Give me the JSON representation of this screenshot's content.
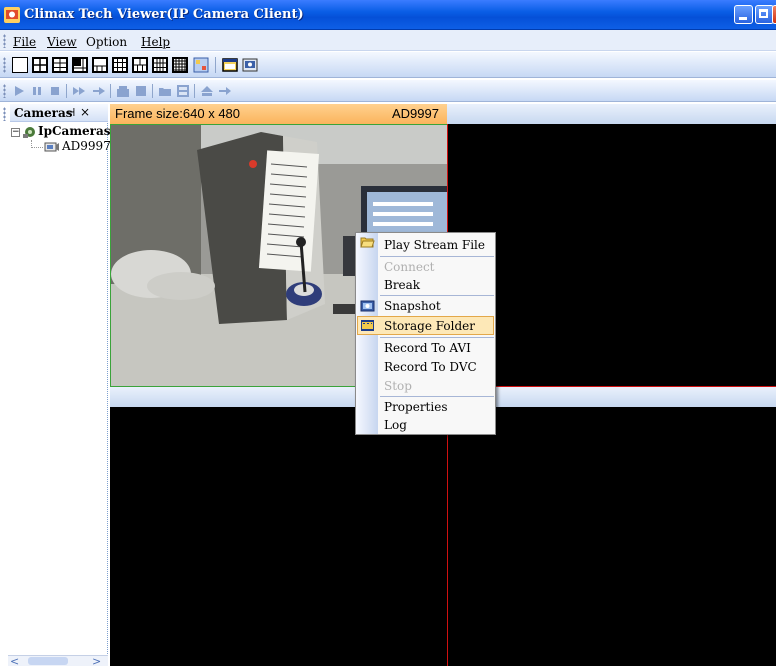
{
  "window": {
    "title": "Climax Tech Viewer(IP Camera Client)"
  },
  "menu": {
    "items": [
      "File",
      "View",
      "Option",
      "Help"
    ],
    "underline_letters": [
      "F",
      "V",
      "p",
      "H"
    ]
  },
  "toolbar1": {
    "icons": [
      "layout-1x1-icon",
      "layout-2x2-icon",
      "layout-3x3-icon",
      "layout-1plus5-icon",
      "layout-1plus7-icon",
      "layout-4x4-icon",
      "layout-2x3-icon",
      "layout-3x4-icon",
      "layout-5x5-icon",
      "settings-grid-icon",
      "fullscreen-icon",
      "snapshot-gallery-icon"
    ]
  },
  "toolbar2": {
    "icons": [
      "play-icon",
      "pause-icon",
      "stop-icon",
      "fast-forward-icon",
      "step-forward-icon",
      "record-icon",
      "stop-record-icon",
      "open-folder-icon",
      "storage-icon",
      "upload-icon",
      "arrow-right-icon"
    ]
  },
  "cameras_panel": {
    "title": "Cameras",
    "pin_glyph": "⊣",
    "close_glyph": "×",
    "tree": {
      "root_label": "IpCameras",
      "expand_glyph": "−",
      "children": [
        "AD9997"
      ]
    }
  },
  "video": {
    "frame_size_label": "Frame size:640 x 480",
    "camera_name": "AD9997"
  },
  "context_menu": {
    "items": [
      {
        "label": "Play Stream File",
        "enabled": true,
        "icon": "open-folder-icon"
      },
      {
        "label": "Connect",
        "enabled": false
      },
      {
        "label": "Break",
        "enabled": true
      },
      {
        "label": "Snapshot",
        "enabled": true,
        "icon": "camera-icon"
      },
      {
        "label": "Storage Folder",
        "enabled": true,
        "icon": "folder-film-icon",
        "highlighted": true
      },
      {
        "label": "Record To AVI",
        "enabled": true
      },
      {
        "label": "Record To DVC",
        "enabled": true
      },
      {
        "label": "Stop",
        "enabled": false
      },
      {
        "label": "Properties",
        "enabled": true
      },
      {
        "label": "Log",
        "enabled": true
      }
    ]
  },
  "colors": {
    "title_bar": "#0a5ee6",
    "active_cell_header": "#fbb45c",
    "selection_border": "#d01010",
    "menu_highlight": "#fde8b7"
  }
}
